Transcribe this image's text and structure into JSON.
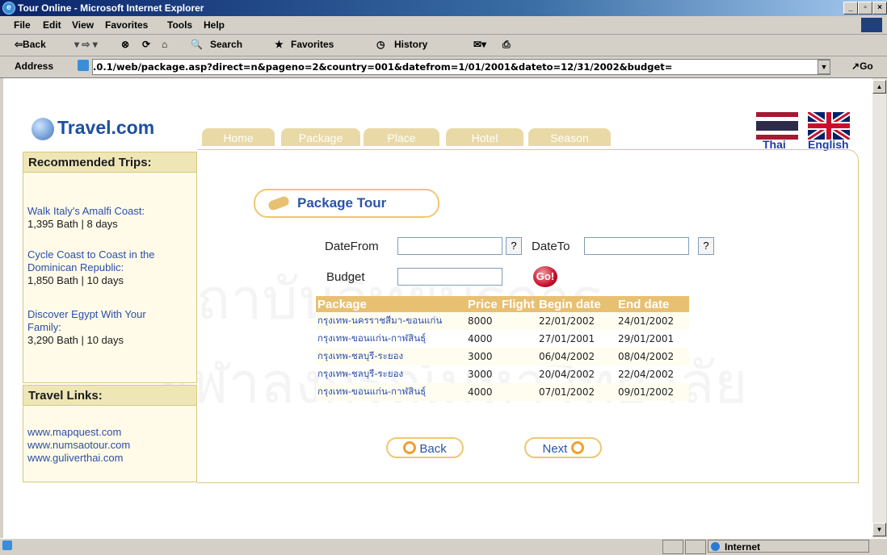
{
  "window": {
    "title": "Tour Online - Microsoft Internet Explorer"
  },
  "menu": [
    "File",
    "Edit",
    "View",
    "Favorites",
    "Tools",
    "Help"
  ],
  "toolbar": {
    "back": "⇦Back",
    "search": "Search",
    "favorites": "Favorites",
    "history": "History"
  },
  "address": {
    "label": "Address",
    "url": "​.0.1/web/package.asp?direct=n&pageno=2&country=001&datefrom=1/01/2001&dateto=12/31/2002&budget=",
    "go": "Go"
  },
  "site": {
    "logo": "Travel.com",
    "nav": [
      "Home",
      "Package",
      "Place",
      "Hotel",
      "Season"
    ],
    "flags": {
      "thai": "Thai",
      "english": "English"
    }
  },
  "sidebar": {
    "recommended_title": "Recommended Trips:",
    "trips": [
      {
        "title": "Walk Italy's Amalfi Coast:",
        "detail": "1,395 Bath | 8 days"
      },
      {
        "title": "Cycle Coast to Coast in the Dominican Republic:",
        "detail": "1,850 Bath | 10 days"
      },
      {
        "title": "Discover Egypt With Your Family:",
        "detail": "3,290 Bath | 10 days"
      }
    ],
    "links_title": "Travel Links:",
    "links": [
      "www.mapquest.com",
      "www.numsaotour.com",
      "www.guliverthai.com"
    ]
  },
  "main": {
    "heading": "Package Tour",
    "form": {
      "date_from": "DateFrom",
      "date_to": "DateTo",
      "budget": "Budget",
      "picker": "?",
      "go": "Go!"
    },
    "table": {
      "headers": [
        "Package",
        "Price",
        "Flight",
        "Begin date",
        "End date"
      ],
      "rows": [
        [
          "กรุงเทพ-นครราชสีมา-ขอนแก่น",
          "8000",
          "",
          "22/01/2002",
          "24/01/2002"
        ],
        [
          "กรุงเทพ-ขอนแก่น-กาฬสินธุ์",
          "4000",
          "",
          "27/01/2001",
          "29/01/2001"
        ],
        [
          "กรุงเทพ-ชลบุรี-ระยอง",
          "3000",
          "",
          "06/04/2002",
          "08/04/2002"
        ],
        [
          "กรุงเทพ-ชลบุรี-ระยอง",
          "3000",
          "",
          "20/04/2002",
          "22/04/2002"
        ],
        [
          "กรุงเทพ-ขอนแก่น-กาฬสินธุ์",
          "4000",
          "",
          "07/01/2002",
          "09/01/2002"
        ]
      ]
    },
    "back": "Back",
    "next": "Next"
  },
  "status": {
    "zone": "Internet"
  },
  "watermark": {
    "line1": "สถาบันวิทยบริการ",
    "line2": "จุฬาลงกรณ์มหาวิทยาลัย"
  }
}
